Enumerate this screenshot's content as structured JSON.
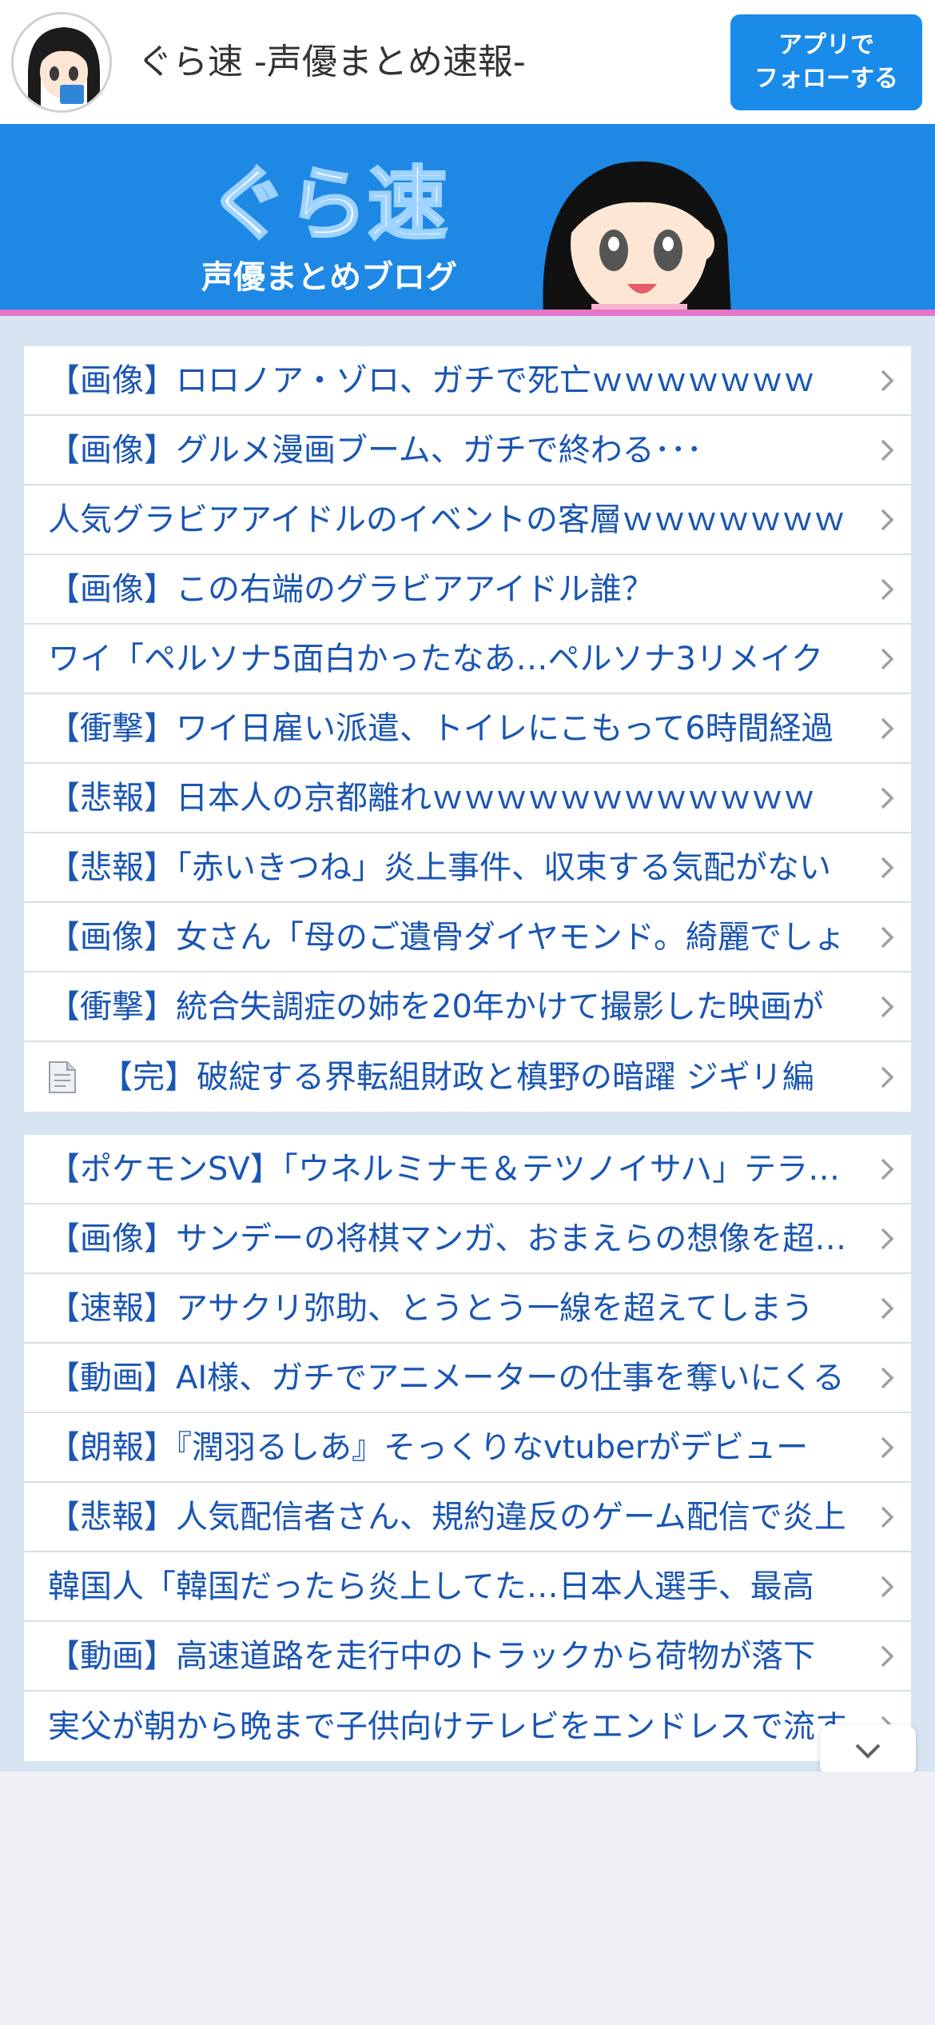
{
  "header": {
    "title": "ぐら速 -声優まとめ速報-",
    "follow_line1": "アプリで",
    "follow_line2": "フォローする"
  },
  "banner": {
    "logo": "ぐら速",
    "subtitle": "声優まとめブログ"
  },
  "list1": [
    {
      "title": "【画像】ロロノア・ゾロ、ガチで死亡ｗｗｗｗｗｗｗ"
    },
    {
      "title": "【画像】グルメ漫画ブーム、ガチで終わる･･･"
    },
    {
      "title": "人気グラビアアイドルのイベントの客層ｗｗｗｗｗｗｗ"
    },
    {
      "title": "【画像】この右端のグラビアアイドル誰？"
    },
    {
      "title": "ワイ「ペルソナ5面白かったなあ…ペルソナ3リメイク"
    },
    {
      "title": "【衝撃】ワイ日雇い派遣、トイレにこもって6時間経過"
    },
    {
      "title": "【悲報】日本人の京都離れｗｗｗｗｗｗｗｗｗｗｗｗ"
    },
    {
      "title": "【悲報】「赤いきつね」炎上事件、収束する気配がない"
    },
    {
      "title": "【画像】女さん「母のご遺骨ダイヤモンド。綺麗でしょ"
    },
    {
      "title": "【衝撃】統合失調症の姉を20年かけて撮影した映画が"
    },
    {
      "title": "【完】破綻する界転組財政と槙野の暗躍 ジギリ編",
      "icon": "document-icon"
    }
  ],
  "list2": [
    {
      "title": "【ポケモンSV】「ウネルミナモ＆テツノイサハ」テラレイド"
    },
    {
      "title": "【画像】サンデーの将棋マンガ、おまえらの想像を超える"
    },
    {
      "title": "【速報】アサクリ弥助、とうとう一線を超えてしまう"
    },
    {
      "title": "【動画】AI様、ガチでアニメーターの仕事を奪いにくる"
    },
    {
      "title": "【朗報】『潤羽るしあ』そっくりなvtuberがデビュー"
    },
    {
      "title": "【悲報】人気配信者さん、規約違反のゲーム配信で炎上"
    },
    {
      "title": "韓国人「韓国だったら炎上してた…日本人選手、最高"
    },
    {
      "title": "【動画】高速道路を走行中のトラックから荷物が落下"
    },
    {
      "title": "実父が朝から晩まで子供向けテレビをエンドレスで流す"
    }
  ],
  "colors": {
    "accent": "#1a8be8",
    "link": "#1a56b3",
    "banner": "#1e88e5",
    "stripe": "#e376c9"
  }
}
